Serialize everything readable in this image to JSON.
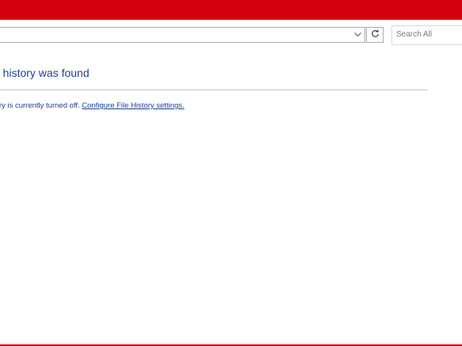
{
  "window": {
    "accent_color": "#d4000f",
    "text_color": "#1c3f94"
  },
  "address_bar": {
    "value": "",
    "dropdown_icon": "chevron-down-icon"
  },
  "refresh": {
    "icon": "refresh-icon"
  },
  "search": {
    "placeholder": "Search All"
  },
  "content": {
    "heading": "e history was found",
    "status_prefix": "tory is currently turned off. ",
    "link_label": "Configure File History settings."
  }
}
